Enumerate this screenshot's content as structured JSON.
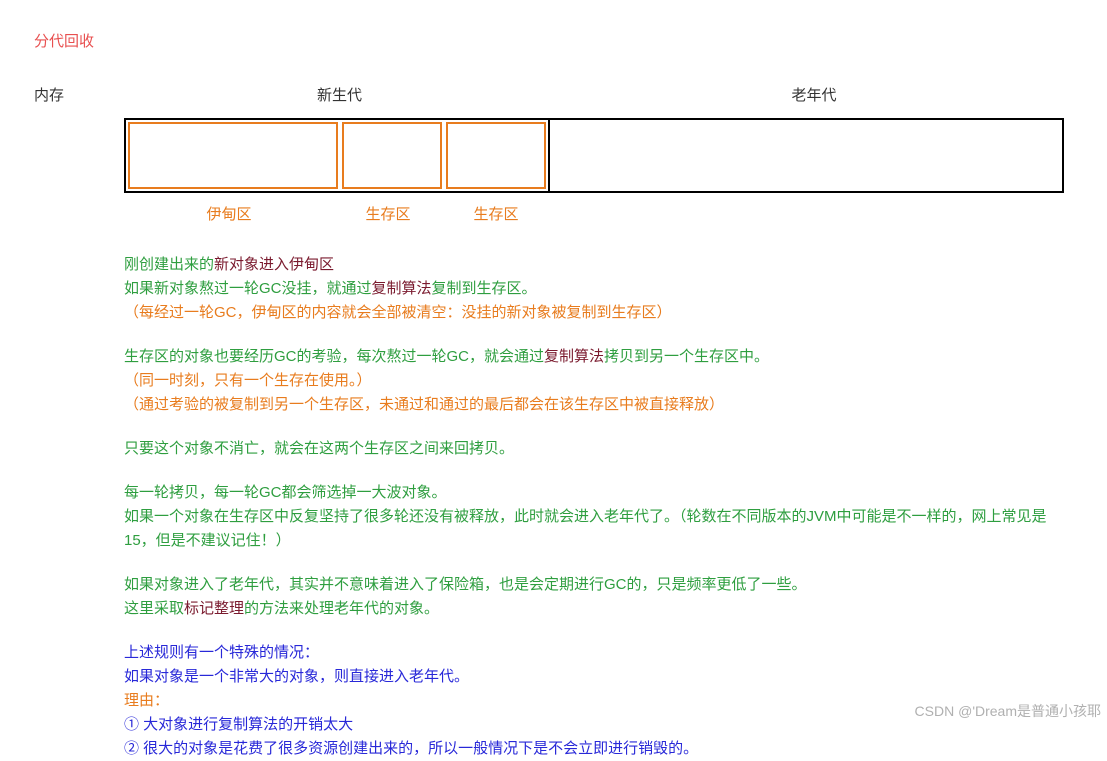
{
  "title": "分代回收",
  "memory_label": "内存",
  "headers": {
    "young": "新生代",
    "old": "老年代"
  },
  "regions": {
    "eden": "伊甸区",
    "survivor1": "生存区",
    "survivor2": "生存区"
  },
  "text": {
    "p1a": "刚创建出来的",
    "p1b": "新对象进入伊甸区",
    "p2a": "如果新对象熬过一轮GC没挂，就通过",
    "p2b": "复制算法",
    "p2c": "复制到生存区。",
    "p3": "（每经过一轮GC，伊甸区的内容就会全部被清空：没挂的新对象被复制到生存区）",
    "p4a": "生存区的对象也要经历GC的考验，每次熬过一轮GC，就会通过",
    "p4b": "复制算法",
    "p4c": "拷贝到另一个生存区中。",
    "p5": "（同一时刻，只有一个生存在使用。）",
    "p6": "（通过考验的被复制到另一个生存区，未通过和通过的最后都会在该生存区中被直接释放）",
    "p7": "只要这个对象不消亡，就会在这两个生存区之间来回拷贝。",
    "p8": "每一轮拷贝，每一轮GC都会筛选掉一大波对象。",
    "p9": "如果一个对象在生存区中反复坚持了很多轮还没有被释放，此时就会进入老年代了。（轮数在不同版本的JVM中可能是不一样的，网上常见是15，但是不建议记住！）",
    "p10": "如果对象进入了老年代，其实并不意味着进入了保险箱，也是会定期进行GC的，只是频率更低了一些。",
    "p11a": "这里采取",
    "p11b": "标记整理",
    "p11c": "的方法来处理老年代的对象。",
    "p12": "上述规则有一个特殊的情况：",
    "p13": "如果对象是一个非常大的对象，则直接进入老年代。",
    "p14": "理由：",
    "p15": "① 大对象进行复制算法的开销太大",
    "p16": "② 很大的对象是花费了很多资源创建出来的，所以一般情况下是不会立即进行销毁的。"
  },
  "watermark": "CSDN @'Dream是普通小孩耶"
}
